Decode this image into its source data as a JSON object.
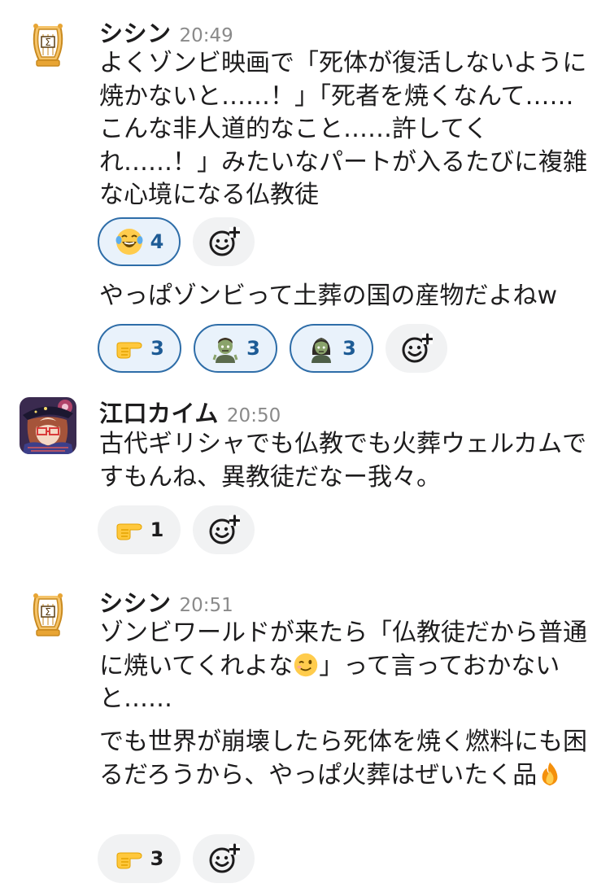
{
  "messages": [
    {
      "author": "シシン",
      "time": "20:49",
      "avatar_icon": "sigma-lyre-icon",
      "paragraphs": [
        {
          "text": "よくゾンビ映画で「死体が復活しないように焼かないと……！」「死者を焼くなんて……こんな非人道的なこと……許してくれ……！」みたいなパートが入るたびに複雑な心境になる仏教徒",
          "reactions": [
            {
              "emoji": "joy-tears-icon",
              "count": "4",
              "selected": true
            }
          ]
        },
        {
          "text": "やっぱゾンビって土葬の国の産物だよねw",
          "reactions": [
            {
              "emoji": "pointing-right-icon",
              "count": "3",
              "selected": true
            },
            {
              "emoji": "zombie-man-icon",
              "count": "3",
              "selected": true
            },
            {
              "emoji": "zombie-woman-icon",
              "count": "3",
              "selected": true
            }
          ]
        }
      ]
    },
    {
      "author": "江口カイム",
      "time": "20:50",
      "avatar_icon": "anime-character-avatar",
      "paragraphs": [
        {
          "text": "古代ギリシャでも仏教でも火葬ウェルカムですもんね、異教徒だなー我々。",
          "reactions": [
            {
              "emoji": "pointing-right-icon",
              "count": "1",
              "selected": false
            }
          ]
        }
      ]
    },
    {
      "author": "シシン",
      "time": "20:51",
      "avatar_icon": "sigma-lyre-icon",
      "paragraphs": [
        {
          "text_before_emoji": "ゾンビワールドが来たら「仏教徒だから普通に焼いてくれよな",
          "inline_emoji": "winking-face-icon",
          "text_after_emoji": "」って言っておかないと……"
        },
        {
          "text": "でも世界が崩壊したら死体を焼く燃料にも困るだろうから、やっぱ火葬はぜいたく品",
          "trailing_emoji": "fire-icon",
          "reactions": [
            {
              "emoji": "pointing-right-icon",
              "count": "3",
              "selected": false
            }
          ]
        }
      ]
    }
  ],
  "add_reaction_icon": "add-reaction-icon",
  "colors": {
    "reaction_selected_border": "#2e6da8",
    "reaction_selected_bg": "#e9f2fb",
    "reaction_bg": "#f1f2f3",
    "timestamp": "#8a8a8a"
  }
}
